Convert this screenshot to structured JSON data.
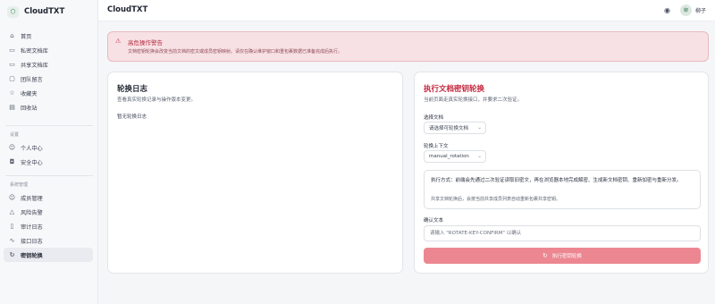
{
  "brand": {
    "name": "CloudTXT",
    "logo_icon": "shield-icon"
  },
  "sidebar": {
    "main_items": [
      {
        "label": "首页",
        "icon": "home-icon"
      },
      {
        "label": "私密文档库",
        "icon": "folder-lock-icon"
      },
      {
        "label": "共享文档库",
        "icon": "folder-share-icon"
      },
      {
        "label": "团队留言",
        "icon": "message-icon"
      },
      {
        "label": "收藏夹",
        "icon": "star-icon"
      },
      {
        "label": "回收站",
        "icon": "trash-icon"
      }
    ],
    "settings_title": "设置",
    "settings_items": [
      {
        "label": "个人中心",
        "icon": "user-icon"
      },
      {
        "label": "安全中心",
        "icon": "lock-icon"
      }
    ],
    "admin_title": "系统管理",
    "admin_items": [
      {
        "label": "成员管理",
        "icon": "users-icon"
      },
      {
        "label": "风险告警",
        "icon": "warning-icon"
      },
      {
        "label": "审计日志",
        "icon": "file-icon"
      },
      {
        "label": "接口日志",
        "icon": "activity-icon"
      },
      {
        "label": "密钥轮换",
        "icon": "rotate-icon",
        "active": true
      }
    ]
  },
  "header": {
    "title": "CloudTXT",
    "user_name": "柳子",
    "avatar_text": "柳"
  },
  "alert": {
    "title": "高危操作警告",
    "description": "文档密钥轮换会改变当前文档的密文或成员密钥映射。请仅在确认维护窗口和重包裹数据已准备完成后执行。"
  },
  "log_card": {
    "title": "轮换日志",
    "subtitle": "查看真实轮换记录与操作版本变更。",
    "empty_text": "暂无轮换日志"
  },
  "rotate_card": {
    "title": "执行文档密钥轮换",
    "subtitle": "当前页面走真实轮换接口，并要求二次验证。",
    "doc_label": "选择文档",
    "doc_value": "请选择可轮换文档",
    "context_label": "轮换上下文",
    "context_value": "manual_rotation",
    "info_main": "执行方式：前端会先通过二次验证读取旧密文，再在浏览器本地完成解密、生成新文档密钥、重新加密与重新分发。",
    "info_note": "共享文档轮换后，会按当前共享成员列表自动重新包裹共享密钥。",
    "confirm_label": "确认文本",
    "confirm_placeholder": "请输入 \"ROTATE-KEY-CONFIRM\" 以确认",
    "button_label": "执行密钥轮换"
  },
  "colors": {
    "danger": "#c3243b",
    "danger_button": "#ec8791",
    "alert_bg": "#f7e1e4"
  }
}
